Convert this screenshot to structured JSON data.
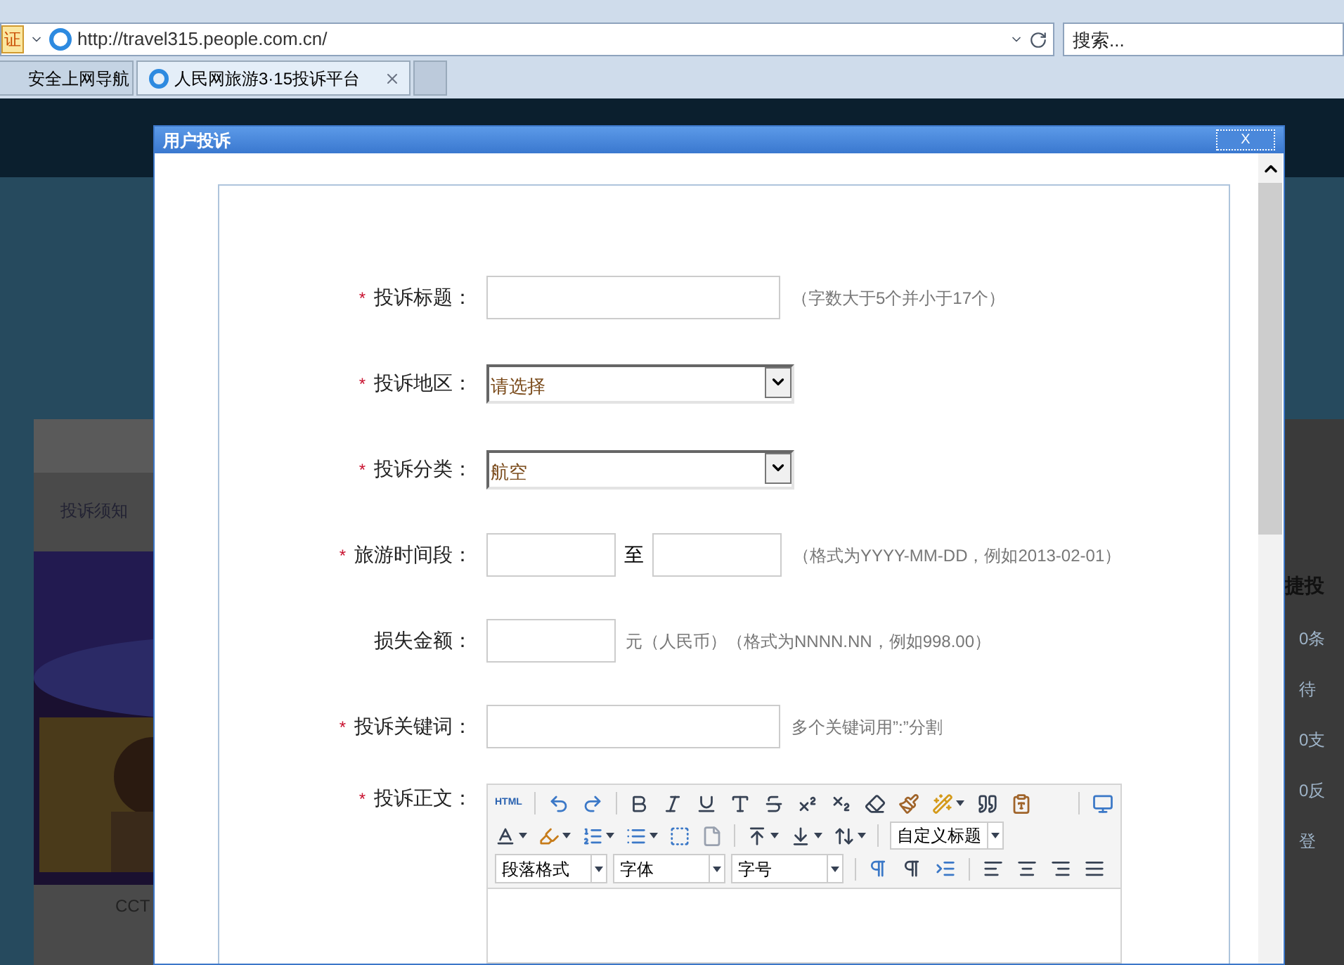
{
  "browser": {
    "security_badge": "证",
    "url": "http://travel315.people.com.cn/",
    "search_placeholder": "搜索...",
    "tabs": [
      {
        "label": "安全上网导航",
        "selected": false
      },
      {
        "label": "人民网旅游3·15投诉平台",
        "selected": true
      }
    ]
  },
  "background_page": {
    "link": "投诉须知",
    "video_caption": "CCT",
    "side_title": "捷投",
    "side_items": [
      "0条",
      "待",
      "0支",
      "0反",
      "登"
    ]
  },
  "dialog": {
    "title": "用户投诉",
    "close": "X",
    "required_mark": "*",
    "fields": [
      {
        "kind": "text",
        "required": true,
        "label": "投诉标题：",
        "hint": "（字数大于5个并小于17个）"
      },
      {
        "kind": "select",
        "required": true,
        "label": "投诉地区：",
        "value": "请选择"
      },
      {
        "kind": "select",
        "required": true,
        "label": "投诉分类：",
        "value": "航空"
      },
      {
        "kind": "daterange",
        "required": true,
        "label": "旅游时间段：",
        "separator": "至",
        "hint": "（格式为YYYY-MM-DD，例如2013-02-01）"
      },
      {
        "kind": "money",
        "required": false,
        "label": "损失金额：",
        "hint": "元（人民币）（格式为NNNN.NN，例如998.00）"
      },
      {
        "kind": "text",
        "required": true,
        "label": "投诉关键词：",
        "hint": "多个关键词用”:”分割"
      },
      {
        "kind": "editor",
        "required": true,
        "label": "投诉正文：",
        "html_label": "HTML",
        "heading": "自定义标题",
        "dropdowns": [
          "段落格式",
          "字体",
          "字号"
        ]
      }
    ]
  }
}
